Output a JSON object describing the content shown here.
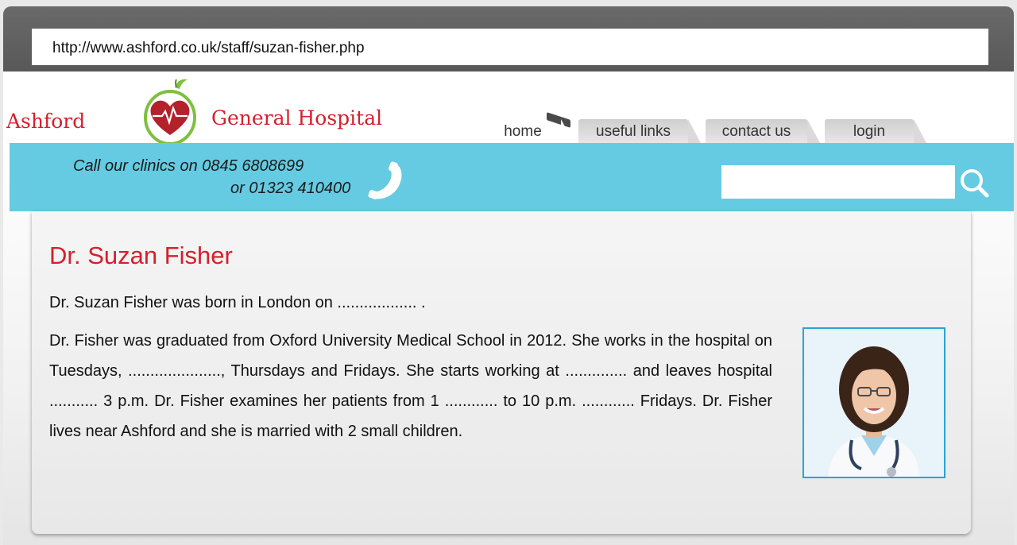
{
  "browser": {
    "url": "http://www.ashford.co.uk/staff/suzan-fisher.php"
  },
  "header": {
    "logo_left": "Ashford",
    "logo_right": "General Hospital",
    "logo_icon": "heart-logo-icon"
  },
  "nav": {
    "tabs": [
      {
        "label": "home",
        "active": true
      },
      {
        "label": "useful links",
        "active": false
      },
      {
        "label": "contact us",
        "active": false
      },
      {
        "label": "login",
        "active": false
      }
    ]
  },
  "infobar": {
    "call_line_1": "Call our clinics on 0845 6808699",
    "call_line_2": "or 01323 410400",
    "phone_icon": "phone-icon",
    "search_placeholder": "",
    "search_icon": "search-icon"
  },
  "main": {
    "title": "Dr. Suzan Fisher",
    "paragraph_1": "Dr. Suzan Fisher was born in London on .................. .",
    "paragraph_2": "Dr. Fisher was graduated from Oxford University Medical School in 2012. She works in the hospital on Tuesdays, ....................., Thursdays and Fridays. She starts working at .............. and leaves hospital ........... 3 p.m. Dr. Fisher examines her patients from 1 ............ to 10 p.m. ............ Fridays. Dr. Fisher lives near Ashford and she is married with 2 small children.",
    "photo": "doctor-portrait"
  },
  "colors": {
    "accent_red": "#d4202c",
    "bar_blue": "#65cbe2",
    "photo_border": "#2aa4d6",
    "chrome_gray": "#5f5f5f"
  }
}
